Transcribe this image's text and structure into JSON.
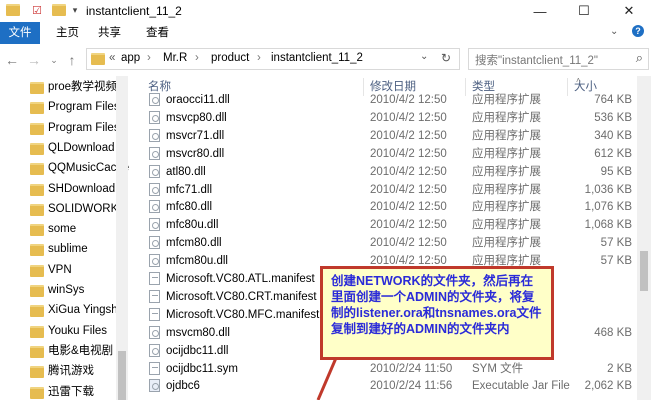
{
  "window": {
    "title": "instantclient_11_2",
    "minimize": "—",
    "maximize": "☐",
    "close": "✕"
  },
  "ribbon": {
    "tabs": [
      "文件",
      "主页",
      "共享",
      "查看"
    ]
  },
  "address": {
    "prefix": "«",
    "crumbs": [
      "app",
      "Mr.R",
      "product",
      "instantclient_11_2"
    ],
    "separator": "›"
  },
  "search": {
    "placeholder": "搜索\"instantclient_11_2\""
  },
  "sidebar": {
    "items": [
      "proe教学视频",
      "Program Files",
      "Program Files",
      "QLDownload",
      "QQMusicCache",
      "SHDownload",
      "SOLIDWORKS",
      "some",
      "sublime",
      "VPN",
      "winSys",
      "XiGua Yingshi",
      "Youku Files",
      "电影&电视剧",
      "腾讯游戏",
      "迅雷下载"
    ]
  },
  "columns": {
    "name": "名称",
    "date": "修改日期",
    "type": "类型",
    "size": "大小"
  },
  "files": [
    {
      "name": "oraocci11.dll",
      "date": "2010/4/2 12:50",
      "type": "应用程序扩展",
      "size": "764 KB",
      "icon": "dll"
    },
    {
      "name": "msvcp80.dll",
      "date": "2010/4/2 12:50",
      "type": "应用程序扩展",
      "size": "536 KB",
      "icon": "dll"
    },
    {
      "name": "msvcr71.dll",
      "date": "2010/4/2 12:50",
      "type": "应用程序扩展",
      "size": "340 KB",
      "icon": "dll"
    },
    {
      "name": "msvcr80.dll",
      "date": "2010/4/2 12:50",
      "type": "应用程序扩展",
      "size": "612 KB",
      "icon": "dll"
    },
    {
      "name": "atl80.dll",
      "date": "2010/4/2 12:50",
      "type": "应用程序扩展",
      "size": "95 KB",
      "icon": "dll"
    },
    {
      "name": "mfc71.dll",
      "date": "2010/4/2 12:50",
      "type": "应用程序扩展",
      "size": "1,036 KB",
      "icon": "dll"
    },
    {
      "name": "mfc80.dll",
      "date": "2010/4/2 12:50",
      "type": "应用程序扩展",
      "size": "1,076 KB",
      "icon": "dll"
    },
    {
      "name": "mfc80u.dll",
      "date": "2010/4/2 12:50",
      "type": "应用程序扩展",
      "size": "1,068 KB",
      "icon": "dll"
    },
    {
      "name": "mfcm80.dll",
      "date": "2010/4/2 12:50",
      "type": "应用程序扩展",
      "size": "57 KB",
      "icon": "dll"
    },
    {
      "name": "mfcm80u.dll",
      "date": "2010/4/2 12:50",
      "type": "应用程序扩展",
      "size": "57 KB",
      "icon": "dll"
    },
    {
      "name": "Microsoft.VC80.ATL.manifest",
      "date": "",
      "type": "",
      "size": "",
      "icon": "doc"
    },
    {
      "name": "Microsoft.VC80.CRT.manifest",
      "date": "",
      "type": "",
      "size": "",
      "icon": "doc"
    },
    {
      "name": "Microsoft.VC80.MFC.manifest",
      "date": "",
      "type": "",
      "size": "",
      "icon": "doc"
    },
    {
      "name": "msvcm80.dll",
      "date": "",
      "type": "",
      "size": "468 KB",
      "icon": "dll"
    },
    {
      "name": "ocijdbc11.dll",
      "date": "",
      "type": "",
      "size": "",
      "icon": "dll"
    },
    {
      "name": "ocijdbc11.sym",
      "date": "2010/2/24 11:50",
      "type": "SYM 文件",
      "size": "2 KB",
      "icon": "doc"
    },
    {
      "name": "ojdbc6",
      "date": "2010/2/24 11:56",
      "type": "Executable Jar File",
      "size": "2,062 KB",
      "icon": "jar"
    }
  ],
  "callout": {
    "text": "创建NETWORK的文件夹，然后再在里面创建一个ADMIN的文件夹，将复制的listener.ora和tnsnames.ora文件复制到建好的ADMIN的文件夹内"
  },
  "colors": {
    "accent": "#1e6fc4",
    "callout_border": "#c0392b",
    "callout_bg": "#ffffc8",
    "callout_text": "#2b2bd8",
    "header_text": "#4d6082"
  }
}
